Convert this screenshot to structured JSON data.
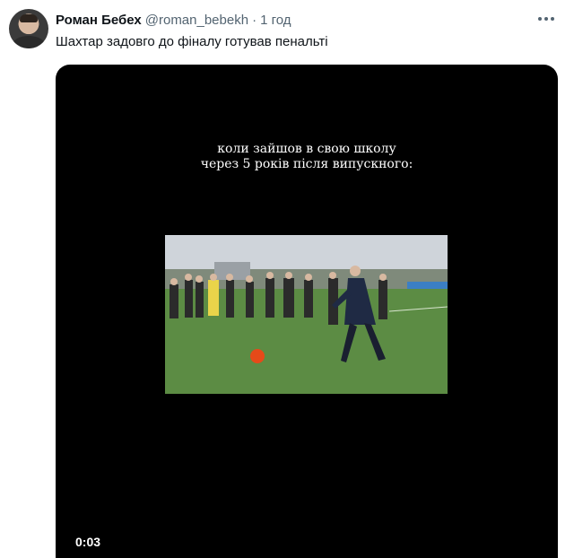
{
  "tweet": {
    "author_name": "Роман Бебех",
    "handle": "@roman_bebekh",
    "separator": "·",
    "time": "1 год",
    "text": "Шахтар задовго до фіналу готував пенальті"
  },
  "video": {
    "caption_line1": "коли зайшов в свою школу",
    "caption_line2": "через 5 років після випускного:",
    "duration": "0:03"
  },
  "colors": {
    "text_primary": "#0f1419",
    "text_secondary": "#536471",
    "video_bg": "#000000",
    "grass": "#5a8a42",
    "ball": "#e64a19"
  },
  "icons": [
    "more-icon"
  ]
}
